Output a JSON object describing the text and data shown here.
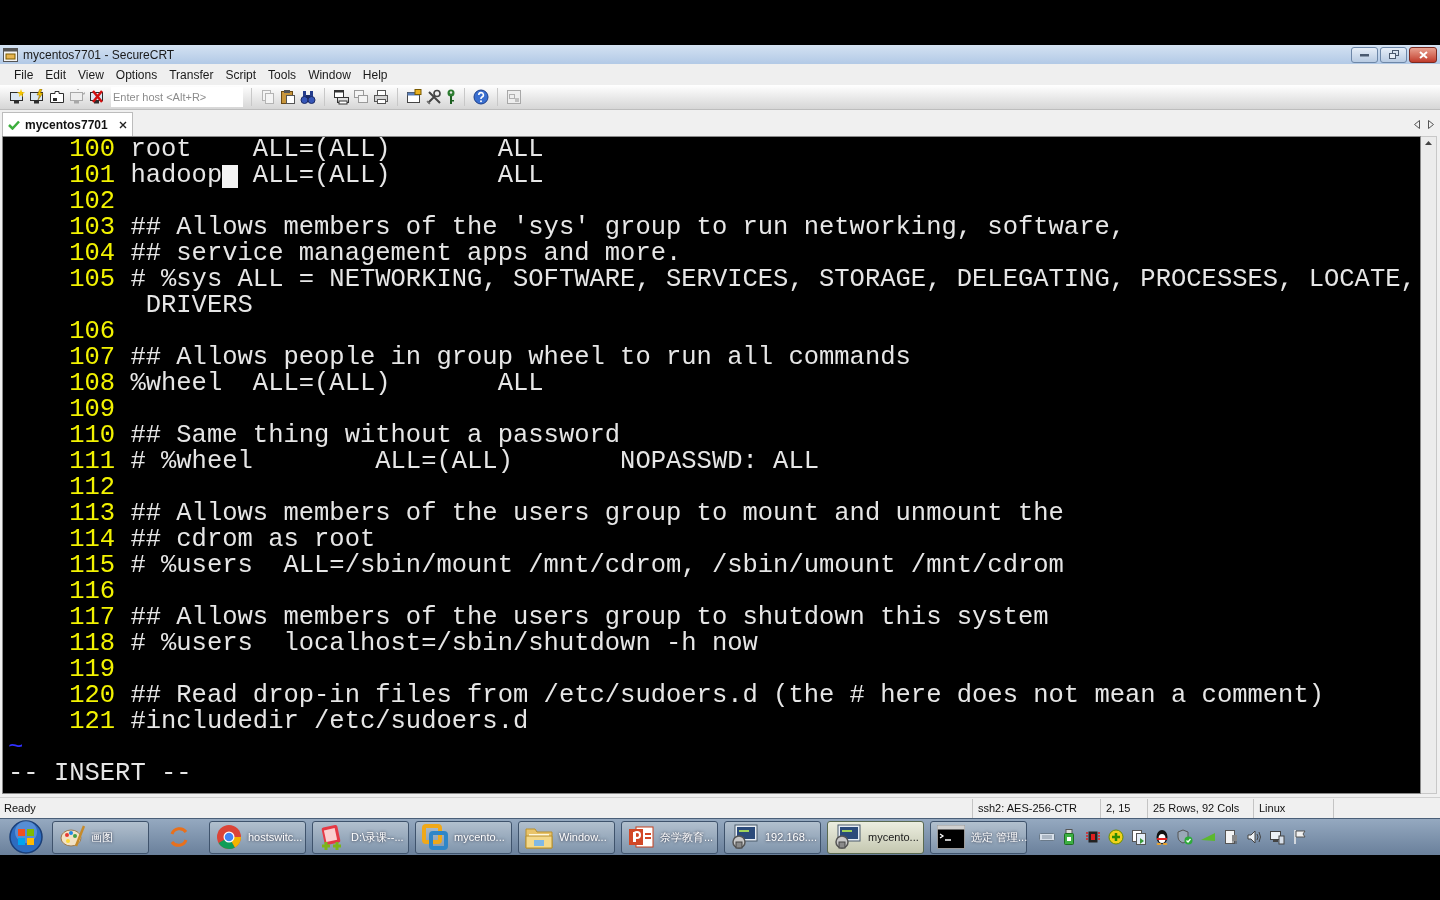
{
  "window": {
    "title": "mycentos7701 - SecureCRT"
  },
  "menu": [
    "File",
    "Edit",
    "View",
    "Options",
    "Transfer",
    "Script",
    "Tools",
    "Window",
    "Help"
  ],
  "toolbar": {
    "host_field": {
      "placeholder": "Enter host <Alt+R>"
    }
  },
  "tabs": [
    {
      "label": "mycentos7701",
      "selected": true
    }
  ],
  "terminal": {
    "lines": [
      {
        "number": "100",
        "text": "root    ALL=(ALL)       ALL"
      },
      {
        "number": "101",
        "text": "hadoop",
        "cursor": true,
        "text_after": " ALL=(ALL)       ALL"
      },
      {
        "number": "102"
      },
      {
        "number": "103",
        "text": "## Allows members of the 'sys' group to run networking, software,"
      },
      {
        "number": "104",
        "text": "## service management apps and more."
      },
      {
        "number": "105",
        "text": "# %sys ALL = NETWORKING, SOFTWARE, SERVICES, STORAGE, DELEGATING, PROCESSES, LOCATE, DRIVERS"
      },
      {
        "number": "106"
      },
      {
        "number": "107",
        "text": "## Allows people in group wheel to run all commands"
      },
      {
        "number": "108",
        "text": "%wheel  ALL=(ALL)       ALL"
      },
      {
        "number": "109"
      },
      {
        "number": "110",
        "text": "## Same thing without a password"
      },
      {
        "number": "111",
        "text": "# %wheel        ALL=(ALL)       NOPASSWD: ALL"
      },
      {
        "number": "112"
      },
      {
        "number": "113",
        "text": "## Allows members of the users group to mount and unmount the"
      },
      {
        "number": "114",
        "text": "## cdrom as root"
      },
      {
        "number": "115",
        "text": "# %users  ALL=/sbin/mount /mnt/cdrom, /sbin/umount /mnt/cdrom"
      },
      {
        "number": "116"
      },
      {
        "number": "117",
        "text": "## Allows members of the users group to shutdown this system"
      },
      {
        "number": "118",
        "text": "# %users  localhost=/sbin/shutdown -h now"
      },
      {
        "number": "119"
      },
      {
        "number": "120",
        "text": "## Read drop-in files from /etc/sudoers.d (the # here does not mean a comment)"
      },
      {
        "number": "121",
        "text": "#includedir /etc/sudoers.d"
      }
    ],
    "filler": [
      "~"
    ],
    "mode_line": "-- INSERT --"
  },
  "status_bar": {
    "message": "Ready",
    "panels": [
      "ssh2: AES-256-CTR",
      "2, 15",
      "25 Rows, 92 Cols",
      "Linux"
    ]
  },
  "taskbar": {
    "items": [
      {
        "kind": "paint",
        "label": "画图",
        "selected": false
      },
      {
        "kind": "loader",
        "selected": false
      },
      {
        "kind": "browser",
        "label": "hostswitc...",
        "selected": false
      },
      {
        "kind": "editor",
        "label": "D:\\录课--...",
        "selected": false
      },
      {
        "kind": "vm",
        "label": "mycento...",
        "selected": false
      },
      {
        "kind": "folder",
        "label": "Window...",
        "selected": false
      },
      {
        "kind": "slides",
        "label": "奈学教育...",
        "selected": false
      },
      {
        "kind": "ssh",
        "label": "192.168....",
        "selected": false
      },
      {
        "kind": "ssh",
        "label": "mycento...",
        "selected": true
      },
      {
        "kind": "console",
        "label": "选定 管理...",
        "selected": false
      }
    ]
  }
}
